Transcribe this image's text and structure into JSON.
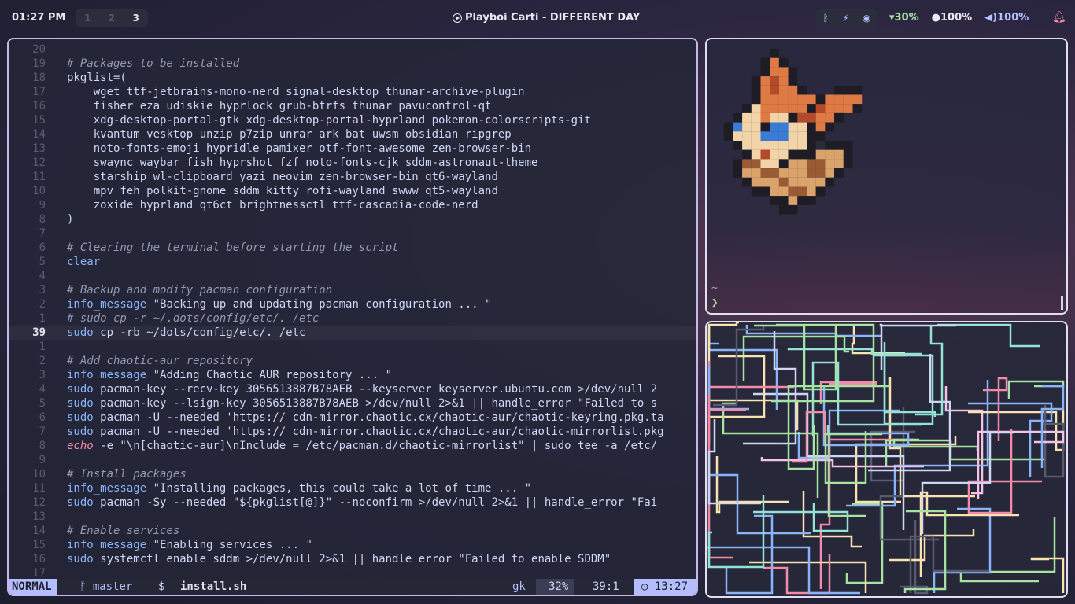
{
  "topbar": {
    "time": "01:27 PM",
    "workspaces": [
      "1",
      "2",
      "3"
    ],
    "active_workspace": "3",
    "media": "Playboi Carti - DIFFERENT DAY",
    "tray_icons": [
      "bluetooth-icon",
      "network-icon",
      "app-icon"
    ],
    "battery": "30%",
    "brightness": "100%",
    "volume": "100%",
    "notifications_icon": "bell-icon"
  },
  "editor": {
    "lines": [
      {
        "n": "20",
        "t": ""
      },
      {
        "n": "19",
        "t": "# Packages to be installed",
        "c": "cmt"
      },
      {
        "n": "18",
        "t": "pkglist=("
      },
      {
        "n": "17",
        "t": "    wget ttf-jetbrains-mono-nerd signal-desktop thunar-archive-plugin"
      },
      {
        "n": "16",
        "t": "    fisher eza udiskie hyprlock grub-btrfs thunar pavucontrol-qt"
      },
      {
        "n": "15",
        "t": "    xdg-desktop-portal-gtk xdg-desktop-portal-hyprland pokemon-colorscripts-git"
      },
      {
        "n": "14",
        "t": "    kvantum vesktop unzip p7zip unrar ark bat uwsm obsidian ripgrep"
      },
      {
        "n": "13",
        "t": "    noto-fonts-emoji hypridle pamixer otf-font-awesome zen-browser-bin"
      },
      {
        "n": "12",
        "t": "    swaync waybar fish hyprshot fzf noto-fonts-cjk sddm-astronaut-theme"
      },
      {
        "n": "11",
        "t": "    starship wl-clipboard yazi neovim zen-browser-bin qt6-wayland"
      },
      {
        "n": "10",
        "t": "    mpv feh polkit-gnome sddm kitty rofi-wayland swww qt5-wayland"
      },
      {
        "n": "9",
        "t": "    zoxide hyprland qt6ct brightnessctl ttf-cascadia-code-nerd"
      },
      {
        "n": "8",
        "t": ")"
      },
      {
        "n": "7",
        "t": ""
      },
      {
        "n": "6",
        "t": "# Clearing the terminal before starting the script",
        "c": "cmt"
      },
      {
        "n": "5",
        "t": "clear",
        "c": "cmd"
      },
      {
        "n": "4",
        "t": ""
      },
      {
        "n": "3",
        "t": "# Backup and modify pacman configuration",
        "c": "cmt"
      },
      {
        "n": "2",
        "t": "info_message \"Backing up and updating pacman configuration ... \""
      },
      {
        "n": "1",
        "t": "# sudo cp -r ~/.dots/config/etc/. /etc",
        "c": "cmt"
      },
      {
        "n": "39",
        "t": "sudo cp -rb ~/dots/config/etc/. /etc",
        "cur": true
      },
      {
        "n": "1",
        "t": ""
      },
      {
        "n": "2",
        "t": "# Add chaotic-aur repository",
        "c": "cmt"
      },
      {
        "n": "3",
        "t": "info_message \"Adding Chaotic AUR repository ... \""
      },
      {
        "n": "4",
        "t": "sudo pacman-key --recv-key 3056513887B78AEB --keyserver keyserver.ubuntu.com >/dev/null 2"
      },
      {
        "n": "5",
        "t": "sudo pacman-key --lsign-key 3056513887B78AEB >/dev/null 2>&1 || handle_error \"Failed to s"
      },
      {
        "n": "6",
        "t": "sudo pacman -U --needed 'https:// cdn-mirror.chaotic.cx/chaotic-aur/chaotic-keyring.pkg.ta"
      },
      {
        "n": "7",
        "t": "sudo pacman -U --needed 'https:// cdn-mirror.chaotic.cx/chaotic-aur/chaotic-mirrorlist.pkg"
      },
      {
        "n": "8",
        "t": "echo -e \"\\n[chaotic-aur]\\nInclude = /etc/pacman.d/chaotic-mirrorlist\" | sudo tee -a /etc/"
      },
      {
        "n": "9",
        "t": ""
      },
      {
        "n": "10",
        "t": "# Install packages",
        "c": "cmt"
      },
      {
        "n": "11",
        "t": "info_message \"Installing packages, this could take a lot of time ... \""
      },
      {
        "n": "12",
        "t": "sudo pacman -Sy --needed \"${pkglist[@]}\" --noconfirm >/dev/null 2>&1 || handle_error \"Fai"
      },
      {
        "n": "13",
        "t": ""
      },
      {
        "n": "14",
        "t": "# Enable services",
        "c": "cmt"
      },
      {
        "n": "15",
        "t": "info_message \"Enabling services ... \""
      },
      {
        "n": "16",
        "t": "sudo systemctl enable sddm >/dev/null 2>&1 || handle_error \"Failed to enable SDDM\""
      },
      {
        "n": "17",
        "t": ""
      }
    ],
    "status": {
      "mode": "NORMAL",
      "branch": "ᚠ master",
      "prompt": "$",
      "file": "install.sh",
      "user": "gk",
      "percent": "32%",
      "position": "39:1",
      "time": "13:27"
    }
  },
  "pokemon_terminal": {
    "tilde": "~",
    "prompt": "❯"
  }
}
